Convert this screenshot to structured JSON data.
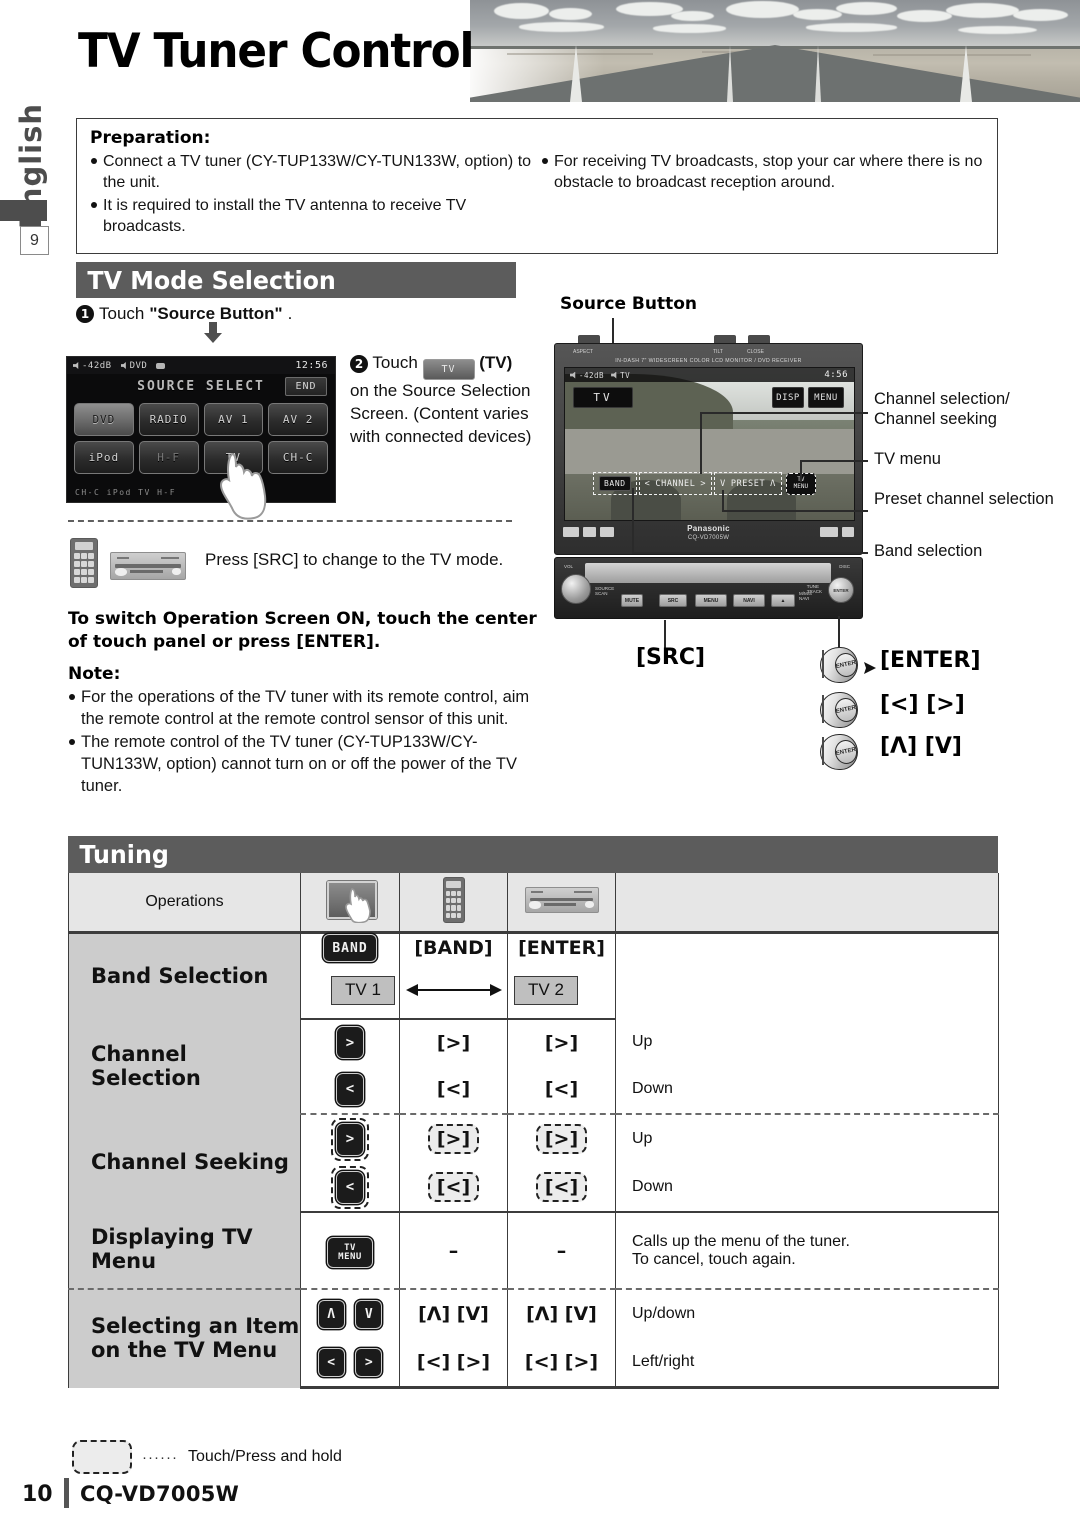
{
  "page": {
    "title": "TV Tuner Control",
    "side_language": "English",
    "side_chapter_number": "9",
    "footer_page_number": "10",
    "footer_model": "CQ-VD7005W"
  },
  "preparation": {
    "heading": "Preparation:",
    "left_items": [
      "Connect a TV tuner (CY-TUP133W/CY-TUN133W, option) to the unit.",
      "It is required to install the TV antenna to receive TV broadcasts."
    ],
    "right_items": [
      "For receiving TV broadcasts, stop your car where there is no obstacle to broadcast reception around."
    ]
  },
  "tv_mode_selection": {
    "section_title": "TV Mode Selection",
    "step1_number": "1",
    "step1_text_prefix": "Touch ",
    "step1_text_bold": "\"Source Button\"",
    "step1_text_suffix": ".",
    "step2_number": "2",
    "step2_touch": "Touch",
    "step2_button_label": "TV",
    "step2_paren": "(TV)",
    "step2_body": "on the Source Selection Screen. (Content varies with connected devices)",
    "src_note": "Press [SRC] to change to the TV mode.",
    "src_note_key": "SRC",
    "operation_screen_note": "To switch Operation Screen ON, touch the center of touch panel or press [ENTER].",
    "note_label": "Note:",
    "notes": [
      "For the operations of the TV tuner with its remote control, aim the remote control at the remote control sensor of this unit.",
      "The remote control of the TV tuner (CY-TUP133W/CY-TUN133W, option) cannot turn on or off the power of the TV tuner."
    ]
  },
  "lcd_source_screen": {
    "status_volume": "-42dB",
    "status_source": "DVD",
    "clock": "12:56",
    "title": "SOURCE SELECT",
    "end_button": "END",
    "buttons": [
      {
        "label": "DVD",
        "state": "highlighted"
      },
      {
        "label": "RADIO",
        "state": "normal"
      },
      {
        "label": "AV 1",
        "state": "normal"
      },
      {
        "label": "AV 2",
        "state": "normal"
      },
      {
        "label": "iPod",
        "state": "normal"
      },
      {
        "label": "H-F",
        "state": "dim"
      },
      {
        "label": "TV",
        "state": "normal"
      },
      {
        "label": "CH-C",
        "state": "normal"
      }
    ],
    "footer_list": "CH-C  iPod  TV  H-F"
  },
  "unit_diagram": {
    "source_button_label": "Source Button",
    "top_left_label": "ASPECT",
    "top_right_labels": [
      "TILT",
      "CLOSE"
    ],
    "monitor_caption": "IN-DASH 7\" WIDESCREEN COLOR LCD MONITOR / DVD RECEIVER",
    "screen_status_volume": "-42dB",
    "screen_status_source": "TV",
    "screen_clock": "4:56",
    "screen_source_button": "TV",
    "screen_disp": "DISP",
    "screen_menu": "MENU",
    "ctrl_band": "BAND",
    "ctrl_left": "<",
    "ctrl_channel": "CHANNEL",
    "ctrl_right": ">",
    "ctrl_down": "V",
    "ctrl_preset": "PRESET",
    "ctrl_up": "Λ",
    "ctrl_tvmenu_line1": "TV",
    "ctrl_tvmenu_line2": "MENU",
    "brand": "Panasonic",
    "model": "CQ-VD7005W",
    "base_keys": [
      "SRC",
      "MENU",
      "NAVI"
    ],
    "callouts": [
      "Channel selection/ Channel seeking",
      "TV menu",
      "Preset channel selection",
      "Band selection"
    ],
    "src_label": "[SRC]",
    "enter_label": "[ENTER]",
    "lr_label": "[<] [>]",
    "ud_label": "[Λ] [V]"
  },
  "tuning": {
    "section_title": "Tuning",
    "header_operations": "Operations",
    "header_icons": [
      "touch-panel-icon",
      "remote-control-icon",
      "head-unit-icon"
    ],
    "rows": [
      {
        "label": "Band Selection",
        "touch": "BAND",
        "remote": "[BAND]",
        "unit": "[ENTER]",
        "description": "",
        "band_from": "TV 1",
        "band_to": "TV 2"
      },
      {
        "label": "Channel Selection",
        "entries": [
          {
            "touch": ">",
            "remote": "[>]",
            "unit": "[>]",
            "description": "Up"
          },
          {
            "touch": "<",
            "remote": "[<]",
            "unit": "[<]",
            "description": "Down"
          }
        ]
      },
      {
        "label": "Channel Seeking",
        "hold": true,
        "entries": [
          {
            "touch": ">",
            "remote": "[>]",
            "unit": "[>]",
            "description": "Up"
          },
          {
            "touch": "<",
            "remote": "[<]",
            "unit": "[<]",
            "description": "Down"
          }
        ]
      },
      {
        "label": "Displaying TV Menu",
        "touch_line1": "TV",
        "touch_line2": "MENU",
        "remote": "–",
        "unit": "–",
        "description_line1": "Calls up the menu of the tuner.",
        "description_line2": "To cancel, touch again."
      },
      {
        "label": "Selecting an Item on the TV Menu",
        "entries": [
          {
            "touch_a": "Λ",
            "touch_b": "V",
            "remote": "[Λ] [V]",
            "unit": "[Λ] [V]",
            "description": "Up/down"
          },
          {
            "touch_a": "<",
            "touch_b": ">",
            "remote": "[<] [>]",
            "unit": "[<] [>]",
            "description": "Left/right"
          }
        ]
      }
    ],
    "legend_text": "Touch/Press and hold",
    "legend_dots": "······"
  }
}
